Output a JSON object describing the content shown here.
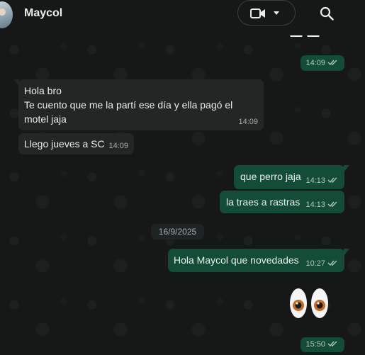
{
  "contact": {
    "name": "Maycol"
  },
  "messages": [
    {
      "direction": "out",
      "text": "",
      "time": "14:09"
    },
    {
      "direction": "in",
      "lines": [
        "Hola bro",
        "Te cuento que me la partí ese día y ella pagó el",
        "motel jaja"
      ],
      "time": "14:09"
    },
    {
      "direction": "in",
      "text": "Llego jueves a SC",
      "time": "14:09"
    },
    {
      "direction": "out",
      "text": "que perro jaja",
      "time": "14:13"
    },
    {
      "direction": "out",
      "text": "la traes a rastras",
      "time": "14:13"
    },
    {
      "direction": "out",
      "text": "Hola Maycol que novedades",
      "time": "10:27"
    },
    {
      "direction": "out",
      "emoji": "eyes",
      "time": "15:50"
    }
  ],
  "date_separator": "16/9/2025",
  "icons": {
    "video": "video-camera-icon",
    "dropdown": "chevron-down-icon",
    "search": "search-icon",
    "read_receipt": "double-check-icon"
  },
  "colors": {
    "outgoing_bubble": "#144d37",
    "incoming_bubble": "#242626",
    "read_tick": "#aec9bd"
  }
}
